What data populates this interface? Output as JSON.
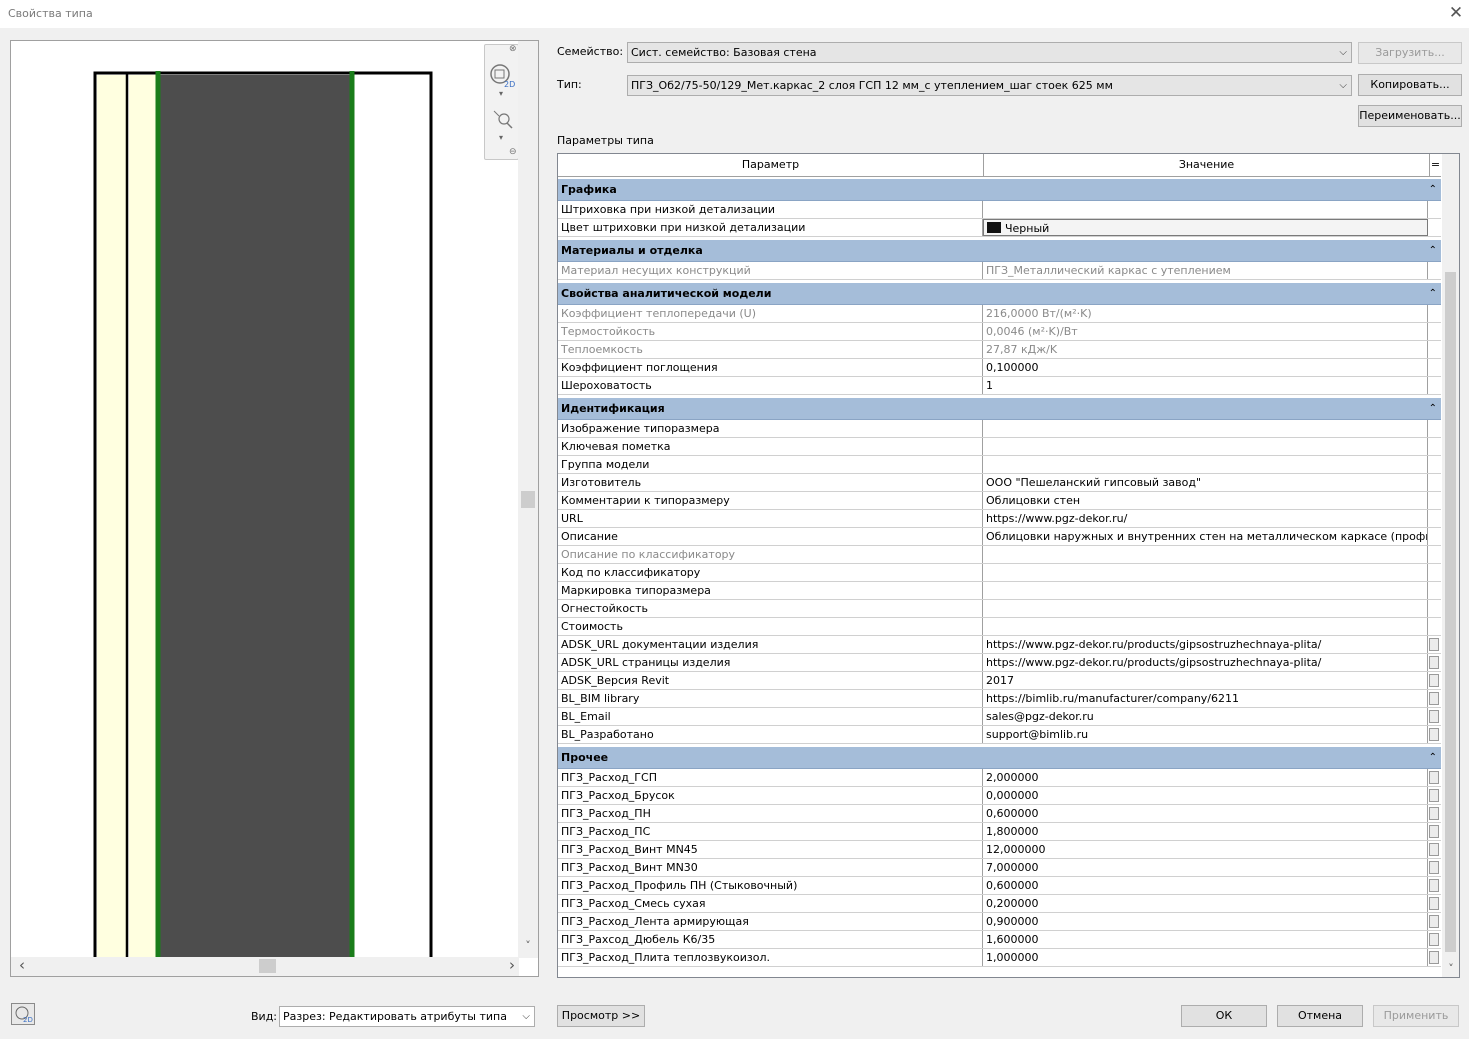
{
  "window": {
    "title": "Свойства типа",
    "close_symbol": "✕"
  },
  "preview": {
    "scroll_up": "▲",
    "scroll_down": "˅",
    "scroll_left": "‹",
    "scroll_right": "›",
    "nav_icons": [
      "close-icon",
      "view-cube-2d-icon",
      "zoom-icon",
      "chevron-down-icon"
    ]
  },
  "family": {
    "label": "Семейство:",
    "value": "Сист. семейство: Базовая стена",
    "load_button": "Загрузить..."
  },
  "type": {
    "label": "Тип:",
    "value": "ПГЗ_Об2/75-50/129_Мет.каркас_2 слоя ГСП 12 мм_с утеплением_шаг стоек 625 мм",
    "copy_button": "Копировать...",
    "rename_button": "Переименовать..."
  },
  "params_label": "Параметры типа",
  "grid": {
    "headers": {
      "param": "Параметр",
      "value": "Значение",
      "sort": "="
    },
    "collapse_symbol": "⌃",
    "groups": [
      {
        "name": "Графика",
        "rows": [
          {
            "param": "Штриховка при низкой детализации",
            "value": "",
            "gray": false
          },
          {
            "param": "Цвет штриховки при низкой детализации",
            "value": "Черный",
            "gray": false,
            "swatch": "#111111"
          }
        ]
      },
      {
        "name": "Материалы и отделка",
        "rows": [
          {
            "param": "Материал несущих конструкций",
            "value": "ПГЗ_Металлический каркас с утеплением",
            "gray": true
          }
        ]
      },
      {
        "name": "Свойства аналитической модели",
        "rows": [
          {
            "param": "Коэффициент теплопередачи (U)",
            "value": "216,0000 Вт/(м²·K)",
            "gray": true
          },
          {
            "param": "Термостойкость",
            "value": "0,0046 (м²·K)/Вт",
            "gray": true
          },
          {
            "param": "Теплоемкость",
            "value": "27,87 кДж/K",
            "gray": true
          },
          {
            "param": "Коэффициент поглощения",
            "value": "0,100000",
            "gray": false
          },
          {
            "param": "Шероховатость",
            "value": "1",
            "gray": false
          }
        ]
      },
      {
        "name": "Идентификация",
        "rows": [
          {
            "param": "Изображение типоразмера",
            "value": "",
            "gray": false
          },
          {
            "param": "Ключевая пометка",
            "value": "",
            "gray": false
          },
          {
            "param": "Группа модели",
            "value": "",
            "gray": false
          },
          {
            "param": "Изготовитель",
            "value": "ООО \"Пешеланский гипсовый завод\"",
            "gray": false
          },
          {
            "param": "Комментарии к типоразмеру",
            "value": "Облицовки стен",
            "gray": false
          },
          {
            "param": "URL",
            "value": "https://www.pgz-dekor.ru/",
            "gray": false
          },
          {
            "param": "Описание",
            "value": "Облицовки наружных и внутренних стен на металлическом каркасе (профиль",
            "gray": false
          },
          {
            "param": "Описание по классификатору",
            "value": "",
            "gray": true
          },
          {
            "param": "Код по классификатору",
            "value": "",
            "gray": false
          },
          {
            "param": "Маркировка типоразмера",
            "value": "",
            "gray": false
          },
          {
            "param": "Огнестойкость",
            "value": "",
            "gray": false
          },
          {
            "param": "Стоимость",
            "value": "",
            "gray": false
          },
          {
            "param": "ADSK_URL документации изделия",
            "value": "https://www.pgz-dekor.ru/products/gipsostruzhechnaya-plita/",
            "gray": false,
            "btn": true
          },
          {
            "param": "ADSK_URL страницы изделия",
            "value": "https://www.pgz-dekor.ru/products/gipsostruzhechnaya-plita/",
            "gray": false,
            "btn": true
          },
          {
            "param": "ADSK_Версия Revit",
            "value": "2017",
            "gray": false,
            "btn": true
          },
          {
            "param": "BL_BIM library",
            "value": "https://bimlib.ru/manufacturer/company/6211",
            "gray": false,
            "btn": true
          },
          {
            "param": "BL_Email",
            "value": "sales@pgz-dekor.ru",
            "gray": false,
            "btn": true
          },
          {
            "param": "BL_Разработано",
            "value": "support@bimlib.ru",
            "gray": false,
            "btn": true
          }
        ]
      },
      {
        "name": "Прочее",
        "rows": [
          {
            "param": "ПГЗ_Расход_ГСП",
            "value": "2,000000",
            "gray": false,
            "btn": true
          },
          {
            "param": "ПГЗ_Расход_Брусок",
            "value": "0,000000",
            "gray": false,
            "btn": true
          },
          {
            "param": "ПГЗ_Расход_ПН",
            "value": "0,600000",
            "gray": false,
            "btn": true
          },
          {
            "param": "ПГЗ_Расход_ПС",
            "value": "1,800000",
            "gray": false,
            "btn": true
          },
          {
            "param": "ПГЗ_Расход_Винт MN45",
            "value": "12,000000",
            "gray": false,
            "btn": true
          },
          {
            "param": "ПГЗ_Расход_Винт MN30",
            "value": "7,000000",
            "gray": false,
            "btn": true
          },
          {
            "param": "ПГЗ_Расход_Профиль ПН (Стыковочный)",
            "value": "0,600000",
            "gray": false,
            "btn": true
          },
          {
            "param": "ПГЗ_Расход_Смесь сухая",
            "value": "0,200000",
            "gray": false,
            "btn": true
          },
          {
            "param": "ПГЗ_Расход_Лента армирующая",
            "value": "0,900000",
            "gray": false,
            "btn": true
          },
          {
            "param": "ПГЗ_Рахсод_Дюбель К6/35",
            "value": "1,600000",
            "gray": false,
            "btn": true
          },
          {
            "param": "ПГЗ_Расход_Плита теплозвукоизол.",
            "value": "1,000000",
            "gray": false,
            "btn": true
          }
        ]
      }
    ]
  },
  "bottom": {
    "view_label": "Вид:",
    "view_value": "Разрез: Редактировать атрибуты типа",
    "preview_button": "Просмотр >>",
    "ok_button": "ОК",
    "cancel_button": "Отмена",
    "apply_button": "Применить"
  },
  "colors": {
    "group_header": "#a5bdd9",
    "wall_core": "#4d4d4d",
    "wall_finish": "#ffffe0",
    "layer_line": "#1a7d1a"
  }
}
